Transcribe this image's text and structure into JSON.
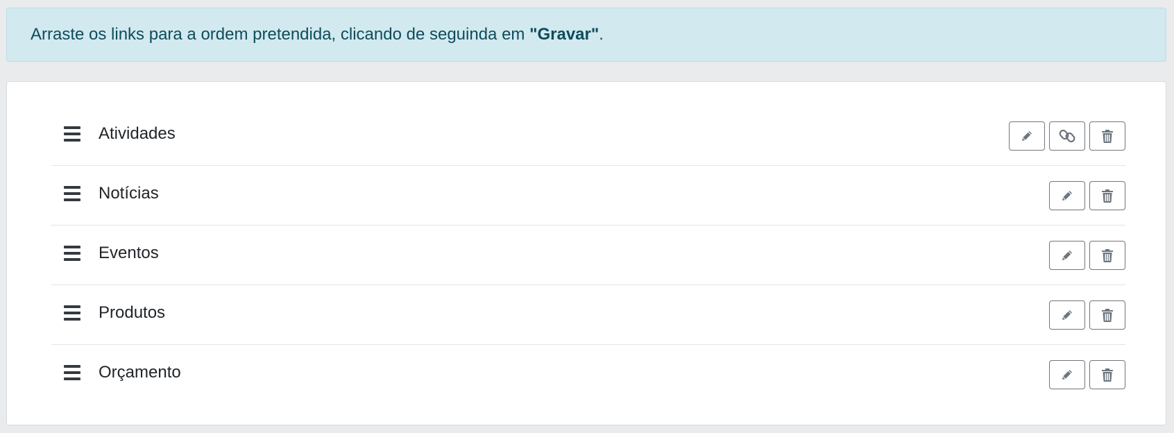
{
  "notice": {
    "text_before": "Arraste os links para a ordem pretendida, clicando de seguinda em ",
    "emphasis": "\"Gravar\"",
    "text_after": "."
  },
  "colors": {
    "notice_background": "#d1e9ef",
    "notice_text": "#0f4c5c",
    "button_border": "#6c757d",
    "icon": "#6c757d"
  },
  "items": [
    {
      "label": "Atividades",
      "actions": [
        "edit-icon",
        "link-icon",
        "trash-icon"
      ]
    },
    {
      "label": "Notícias",
      "actions": [
        "edit-icon",
        "trash-icon"
      ]
    },
    {
      "label": "Eventos",
      "actions": [
        "edit-icon",
        "trash-icon"
      ]
    },
    {
      "label": "Produtos",
      "actions": [
        "edit-icon",
        "trash-icon"
      ]
    },
    {
      "label": "Orçamento",
      "actions": [
        "edit-icon",
        "trash-icon"
      ]
    }
  ]
}
